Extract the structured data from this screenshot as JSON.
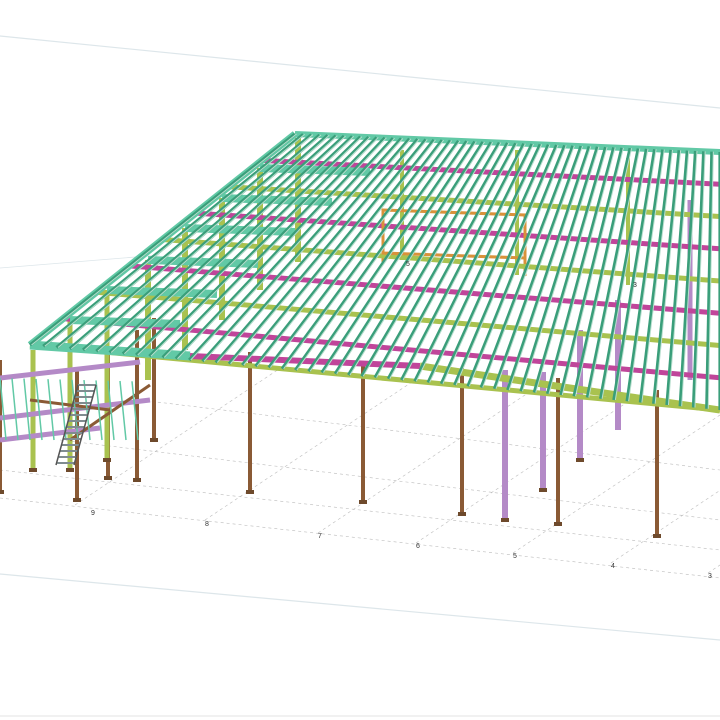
{
  "gridlines": {
    "numbers": [
      "9",
      "8",
      "7",
      "6",
      "5",
      "4",
      "3"
    ],
    "interior_marks": [
      "5",
      "3"
    ]
  },
  "colors": {
    "background": "#ffffff",
    "roof_beam": "#3a9e7a",
    "roof_beam_light": "#b9e0cf",
    "main_beam": "#62c9a6",
    "purlin_edge": "#2f7d61",
    "magenta_beam": "#c0459a",
    "olive_beam": "#a9c24f",
    "brown_column": "#8a5a35",
    "lavender_column": "#b48ac7",
    "orange_frame": "#d9923a",
    "gridline": "#bbbbbb"
  },
  "elements": {
    "roof_purlins": "roof-purlin-icon",
    "columns": "steel-column-icon",
    "stair": "stair-icon"
  }
}
